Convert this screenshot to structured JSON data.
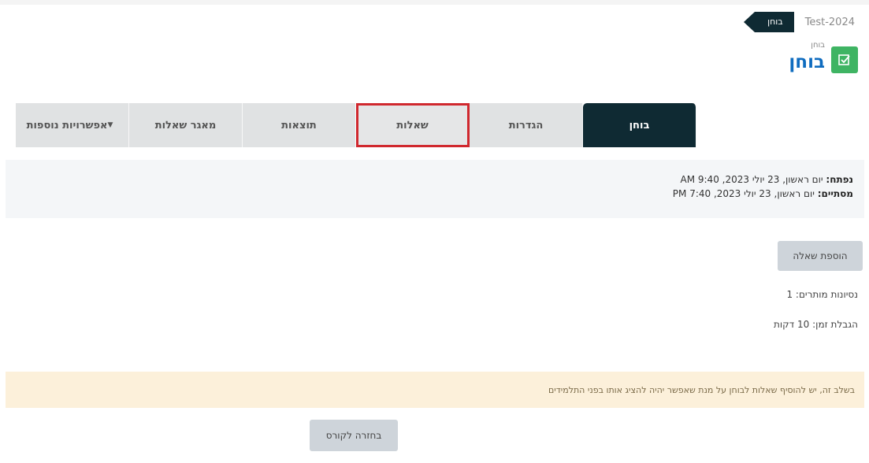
{
  "breadcrumb": {
    "course": "Test-2024",
    "activity": "בוחן"
  },
  "header": {
    "label": "בוחן",
    "title": "בוחן"
  },
  "tabs": [
    {
      "label": "בוחן",
      "active": true
    },
    {
      "label": "הגדרות"
    },
    {
      "label": "שאלות",
      "highlighted": true
    },
    {
      "label": "תוצאות"
    },
    {
      "label": "מאגר שאלות"
    },
    {
      "label": "אפשרויות נוספות"
    }
  ],
  "dates": {
    "opened_label": "נפתח:",
    "opened_value": "יום ראשון, 23 יולי 2023, 9:40 AM",
    "closes_label": "מסתיים:",
    "closes_value": "יום ראשון, 23 יולי 2023, 7:40 PM"
  },
  "actions": {
    "add_question": "הוספת שאלה",
    "back_to_course": "בחזרה לקורס"
  },
  "info": {
    "attempts_allowed": "נסיונות מותרים: 1",
    "time_limit": "הגבלת זמן: 10 דקות"
  },
  "alert": {
    "text": "בשלב זה, יש להוסיף שאלות לבוחן על מנת שאפשר יהיה להציג אותו בפני התלמידים"
  },
  "colors": {
    "accent": "#0f6cbf",
    "tab_active": "#0f2a33",
    "highlight": "#d0282e",
    "icon_bg": "#3fb463",
    "alert_bg": "#fcf0da"
  },
  "icons": {
    "activity": "quiz-checkbox-icon",
    "more": "caret-down-icon"
  }
}
